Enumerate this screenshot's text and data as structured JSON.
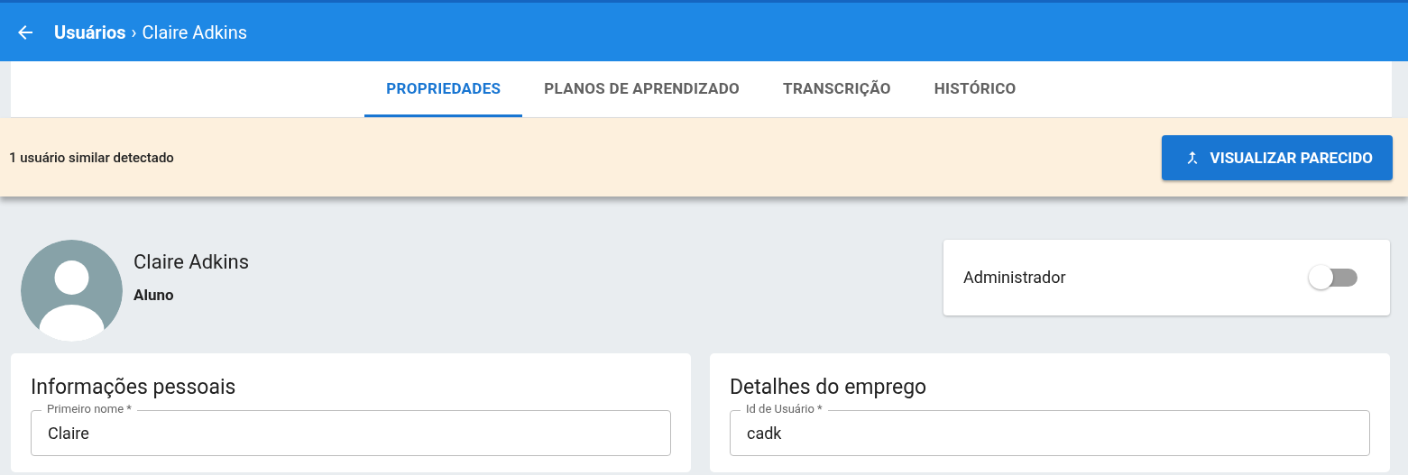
{
  "header": {
    "breadcrumb": {
      "parent": "Usuários",
      "separator": "›",
      "current": "Claire Adkins"
    }
  },
  "tabs": [
    {
      "label": "PROPRIEDADES",
      "selected": true
    },
    {
      "label": "PLANOS DE APRENDIZADO",
      "selected": false
    },
    {
      "label": "TRANSCRIÇÃO",
      "selected": false
    },
    {
      "label": "HISTÓRICO",
      "selected": false
    }
  ],
  "banner": {
    "message": "1 usuário similar detectado",
    "button": "VISUALIZAR PARECIDO"
  },
  "profile": {
    "name": "Claire Adkins",
    "role": "Aluno"
  },
  "admin": {
    "label": "Administrador",
    "on": false
  },
  "cards": [
    {
      "title": "Informações pessoais",
      "fields": [
        {
          "label": "Primeiro nome *",
          "value": "Claire"
        }
      ]
    },
    {
      "title": "Detalhes do emprego",
      "fields": [
        {
          "label": "Id de Usuário *",
          "value": "cadk"
        }
      ]
    }
  ]
}
